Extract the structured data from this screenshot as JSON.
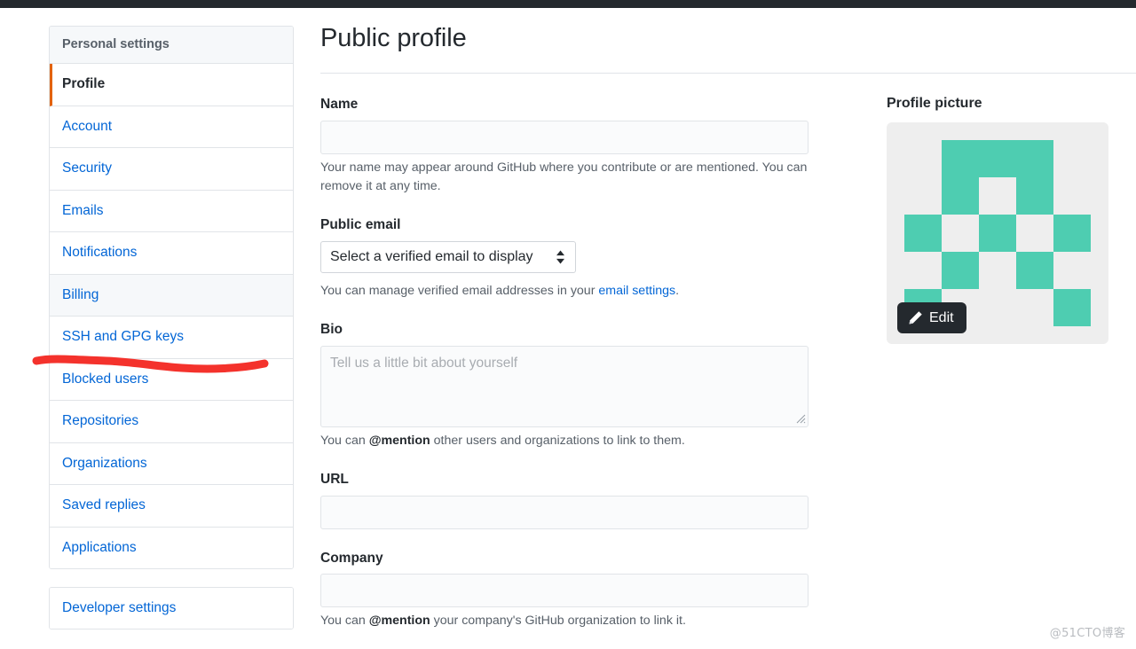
{
  "sidebar": {
    "header": "Personal settings",
    "items": [
      {
        "label": "Profile",
        "selected": true,
        "shaded": false
      },
      {
        "label": "Account",
        "selected": false,
        "shaded": false
      },
      {
        "label": "Security",
        "selected": false,
        "shaded": false
      },
      {
        "label": "Emails",
        "selected": false,
        "shaded": false
      },
      {
        "label": "Notifications",
        "selected": false,
        "shaded": false
      },
      {
        "label": "Billing",
        "selected": false,
        "shaded": true
      },
      {
        "label": "SSH and GPG keys",
        "selected": false,
        "shaded": false
      },
      {
        "label": "Blocked users",
        "selected": false,
        "shaded": false
      },
      {
        "label": "Repositories",
        "selected": false,
        "shaded": false
      },
      {
        "label": "Organizations",
        "selected": false,
        "shaded": false
      },
      {
        "label": "Saved replies",
        "selected": false,
        "shaded": false
      },
      {
        "label": "Applications",
        "selected": false,
        "shaded": false
      }
    ],
    "developer_settings": "Developer settings",
    "annotation": {
      "type": "hand-drawn-underline",
      "color": "#f4322c",
      "targets": "SSH and GPG keys"
    }
  },
  "main": {
    "title": "Public profile",
    "name": {
      "label": "Name",
      "value": "",
      "placeholder": "",
      "hint_before": "Your name may appear around GitHub where you contribute or are mentioned. You can remove it at any time."
    },
    "public_email": {
      "label": "Public email",
      "selected_option": "Select a verified email to display",
      "options": [
        "Select a verified email to display"
      ],
      "hint_before": "You can manage verified email addresses in your ",
      "hint_link": "email settings",
      "hint_after": "."
    },
    "bio": {
      "label": "Bio",
      "value": "",
      "placeholder": "Tell us a little bit about yourself",
      "hint_before": "You can ",
      "hint_bold": "@mention",
      "hint_after": " other users and organizations to link to them."
    },
    "url": {
      "label": "URL",
      "value": "",
      "placeholder": ""
    },
    "company": {
      "label": "Company",
      "value": "",
      "placeholder": "",
      "hint_before": "You can ",
      "hint_bold": "@mention",
      "hint_after": " your company's GitHub organization to link it."
    }
  },
  "avatar": {
    "title": "Profile picture",
    "edit_label": "Edit",
    "identicon_color": "#4ecdb1",
    "identicon_background": "#eeeeee",
    "identicon_grid": [
      [
        0,
        1,
        1,
        1,
        0
      ],
      [
        0,
        1,
        0,
        1,
        0
      ],
      [
        1,
        0,
        1,
        0,
        1
      ],
      [
        0,
        1,
        0,
        1,
        0
      ],
      [
        1,
        0,
        0,
        0,
        1
      ]
    ]
  },
  "watermark": "@51CTO博客",
  "colors": {
    "link": "#0366d6",
    "text": "#24292e",
    "muted": "#586069",
    "border": "#e1e4e8",
    "accent_active": "#e36209",
    "annotation_red": "#f4322c",
    "avatar_teal": "#4ecdb1"
  }
}
